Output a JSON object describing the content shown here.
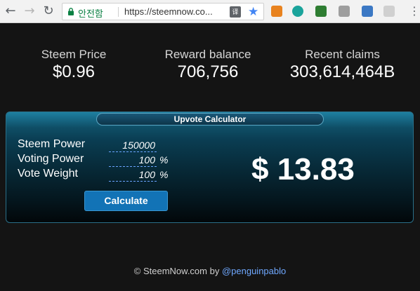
{
  "browser": {
    "secure_label": "안전함",
    "url": "https://steemnow.co...",
    "back_glyph": "←",
    "forward_glyph": "→",
    "reload_glyph": "↻",
    "star_glyph": "★",
    "menu_glyph": "⋮",
    "translate_glyph": "译",
    "accent": "#4285f4",
    "secure_color": "#0b8043"
  },
  "stats": [
    {
      "label": "Steem Price",
      "value": "$0.96"
    },
    {
      "label": "Reward balance",
      "value": "706,756"
    },
    {
      "label": "Recent claims",
      "value": "303,614,464B"
    }
  ],
  "calculator": {
    "title": "Upvote Calculator",
    "fields": [
      {
        "label": "Steem Power",
        "value": "150000",
        "unit": ""
      },
      {
        "label": "Voting Power",
        "value": "100",
        "unit": "%"
      },
      {
        "label": "Vote Weight",
        "value": "100",
        "unit": "%"
      }
    ],
    "button_label": "Calculate",
    "result": "$ 13.83"
  },
  "footer": {
    "text": "© SteemNow.com by ",
    "link": "@penguinpablo"
  }
}
